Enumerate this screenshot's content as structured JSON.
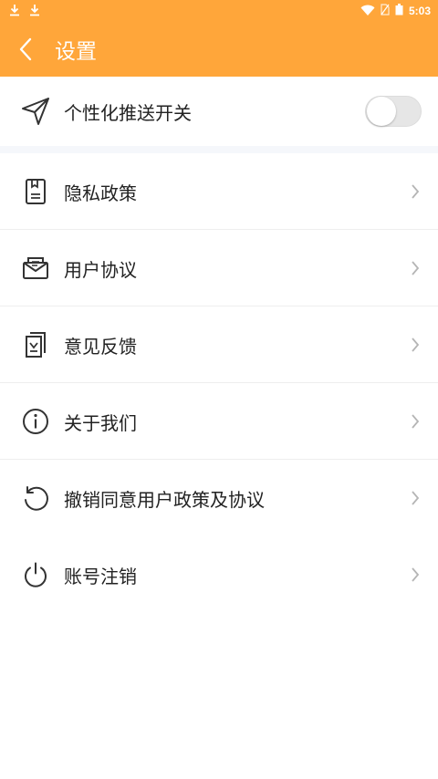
{
  "status_bar": {
    "time": "5:03"
  },
  "header": {
    "title": "设置"
  },
  "push": {
    "label": "个性化推送开关",
    "enabled": false
  },
  "menu": [
    {
      "label": "隐私政策",
      "icon": "document-icon"
    },
    {
      "label": "用户协议",
      "icon": "envelope-icon"
    },
    {
      "label": "意见反馈",
      "icon": "feedback-icon"
    },
    {
      "label": "关于我们",
      "icon": "info-icon"
    },
    {
      "label": "撤销同意用户政策及协议",
      "icon": "undo-icon"
    },
    {
      "label": "账号注销",
      "icon": "power-icon"
    }
  ],
  "colors": {
    "accent": "#FFA63A",
    "text": "#222222",
    "chevron": "#b5b5b5"
  }
}
